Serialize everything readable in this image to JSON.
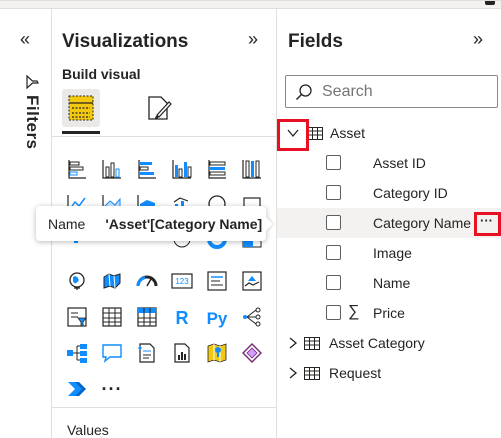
{
  "filters": {
    "label": "Filters",
    "collapse_glyph": "«",
    "icon": "filter-icon"
  },
  "visualizations": {
    "title": "Visualizations",
    "expand_glyph": "»",
    "build_visual_label": "Build visual",
    "tabs": [
      {
        "name": "build-visual",
        "icon": "table-fields-icon",
        "active": true
      },
      {
        "name": "format-visual",
        "icon": "paintbrush-page-icon",
        "active": false
      }
    ],
    "icons": [
      "stacked-bar-chart-icon",
      "stacked-column-chart-icon",
      "clustered-bar-chart-icon",
      "clustered-column-chart-icon",
      "100-stacked-bar-chart-icon",
      "100-stacked-column-chart-icon",
      "line-chart-icon",
      "area-chart-icon",
      "stacked-area-chart-icon",
      "line-column-chart-icon",
      "line-clustered-column-chart-icon",
      "ribbon-chart-icon",
      "waterfall-chart-icon",
      "funnel-chart-icon",
      "scatter-chart-icon",
      "pie-chart-icon",
      "donut-chart-icon",
      "treemap-icon",
      "map-icon",
      "filled-map-icon",
      "gauge-icon",
      "card-icon",
      "multi-row-card-icon",
      "kpi-icon",
      "slicer-icon",
      "table-icon",
      "matrix-icon",
      "r-visual-icon",
      "python-visual-icon",
      "key-influencers-icon",
      "decomposition-tree-icon",
      "qna-icon",
      "smart-narrative-icon",
      "paginated-report-icon",
      "azure-map-icon",
      "power-apps-icon",
      "power-automate-icon",
      "more-visuals-icon"
    ],
    "r_glyph": "R",
    "py_glyph": "Py",
    "card_text": "123",
    "more_glyph": "···",
    "values_label": "Values"
  },
  "tooltip": {
    "key": "Name",
    "value": "'Asset'[Category Name]"
  },
  "fields": {
    "title": "Fields",
    "expand_glyph": "»",
    "search_placeholder": "Search",
    "tables": [
      {
        "name": "Asset",
        "expanded": true,
        "fields": [
          {
            "name": "Asset ID",
            "sigma": false,
            "checked": false
          },
          {
            "name": "Category ID",
            "sigma": false,
            "checked": false
          },
          {
            "name": "Category Name",
            "sigma": false,
            "checked": false,
            "hover": true,
            "more_glyph": "···"
          },
          {
            "name": "Image",
            "sigma": false,
            "checked": false
          },
          {
            "name": "Name",
            "sigma": false,
            "checked": false
          },
          {
            "name": "Price",
            "sigma": true,
            "sigma_glyph": "∑",
            "checked": false
          }
        ]
      },
      {
        "name": "Asset Category",
        "expanded": false
      },
      {
        "name": "Request",
        "expanded": false
      }
    ],
    "highlight_color": "#e81123"
  }
}
